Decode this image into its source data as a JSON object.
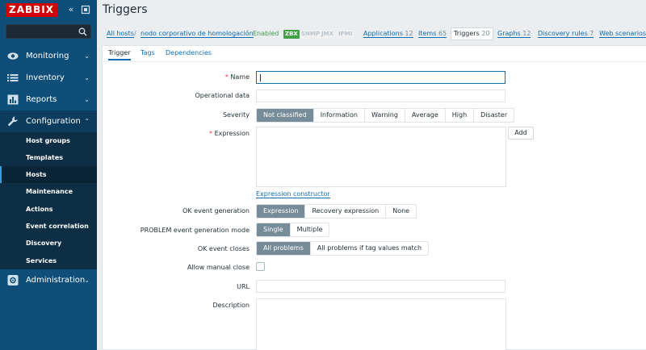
{
  "sidebar": {
    "logo": "ZABBIX",
    "collapse_glyph": "«",
    "search_placeholder": "",
    "menu": [
      {
        "label": "Monitoring",
        "icon": "eye-icon"
      },
      {
        "label": "Inventory",
        "icon": "list-icon"
      },
      {
        "label": "Reports",
        "icon": "bar-chart-icon"
      },
      {
        "label": "Configuration",
        "icon": "wrench-icon"
      },
      {
        "label": "Administration",
        "icon": "gear-icon"
      }
    ],
    "caret_down": "⌄",
    "caret_up": "⌃",
    "submenu": [
      "Host groups",
      "Templates",
      "Hosts",
      "Maintenance",
      "Actions",
      "Event correlation",
      "Discovery",
      "Services"
    ],
    "selected_submenu": "Hosts"
  },
  "header": {
    "title": "Triggers"
  },
  "breadcrumbs": {
    "all_hosts": "All hosts",
    "sep": "/",
    "host": "nodo corporativo de homologación",
    "status": "Enabled",
    "badges": [
      "ZBX",
      "SNMP",
      "JMX",
      "IPMI"
    ],
    "nav": [
      {
        "label": "Applications",
        "count": "12"
      },
      {
        "label": "Items",
        "count": "65"
      },
      {
        "label": "Triggers",
        "count": "20"
      },
      {
        "label": "Graphs",
        "count": "12"
      },
      {
        "label": "Discovery rules",
        "count": "7"
      },
      {
        "label": "Web scenarios",
        "count": ""
      }
    ]
  },
  "tabs": [
    "Trigger",
    "Tags",
    "Dependencies"
  ],
  "form": {
    "name_label": "Name",
    "name_value": "",
    "opdata_label": "Operational data",
    "severity_label": "Severity",
    "severity_options": [
      "Not classified",
      "Information",
      "Warning",
      "Average",
      "High",
      "Disaster"
    ],
    "severity_selected": "Not classified",
    "expression_label": "Expression",
    "add_button": "Add",
    "expression_constructor": "Expression constructor",
    "ok_event_label": "OK event generation",
    "ok_event_options": [
      "Expression",
      "Recovery expression",
      "None"
    ],
    "ok_event_selected": "Expression",
    "problem_mode_label": "PROBLEM event generation mode",
    "problem_mode_options": [
      "Single",
      "Multiple"
    ],
    "problem_mode_selected": "Single",
    "ok_closes_label": "OK event closes",
    "ok_closes_options": [
      "All problems",
      "All problems if tag values match"
    ],
    "ok_closes_selected": "All problems",
    "manual_close_label": "Allow manual close",
    "manual_close_checked": false,
    "url_label": "URL",
    "url_value": "",
    "description_label": "Description",
    "required_mark": "*"
  }
}
